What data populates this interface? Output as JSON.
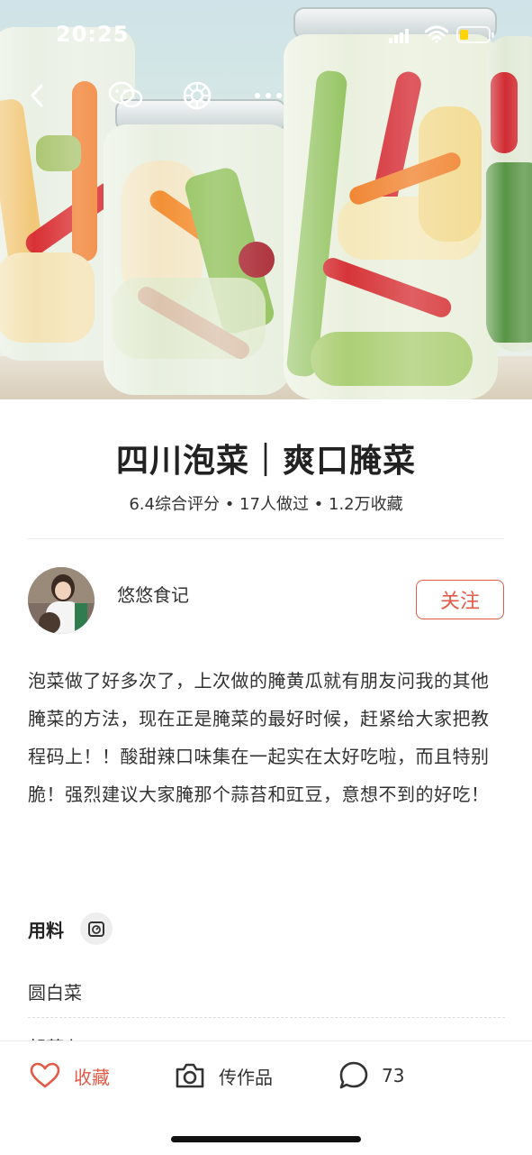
{
  "status_bar": {
    "time": "20:25",
    "battery_level": 0.3,
    "battery_color": "#ffd400"
  },
  "nav": {
    "back_icon": "chevron-left-icon",
    "wechat_icon": "wechat-icon",
    "moments_icon": "moments-icon",
    "more_icon": "more-icon"
  },
  "recipe": {
    "title": "四川泡菜｜爽口腌菜",
    "stats": "6.4综合评分 • 17人做过 • 1.2万收藏"
  },
  "author": {
    "name": "悠悠食记",
    "follow_label": "关注"
  },
  "description": "泡菜做了好多次了，上次做的腌黄瓜就有朋友问我的其他腌菜的方法，现在正是腌菜的最好时候，赶紧给大家把教程码上！！酸甜辣口味集在一起实在太好吃啦，而且特别脆！强烈建议大家腌那个蒜苔和豇豆，意想不到的好吃！",
  "ingredients": {
    "section_label": "用料",
    "items": [
      "圆白菜",
      "胡萝卜"
    ]
  },
  "bottom_bar": {
    "favorite_label": "收藏",
    "upload_label": "传作品",
    "comment_count": "73"
  },
  "colors": {
    "accent": "#e35a46"
  }
}
